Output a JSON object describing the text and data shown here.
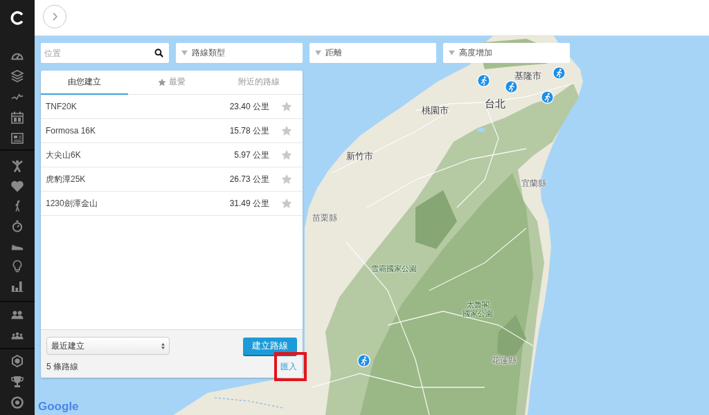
{
  "filters": {
    "location": {
      "placeholder": "位置"
    },
    "dropdowns": [
      {
        "label": "路線類型"
      },
      {
        "label": "距離"
      },
      {
        "label": "高度增加"
      }
    ]
  },
  "panel": {
    "tabs": [
      {
        "label": "由您建立",
        "kind": "plain",
        "selected": true
      },
      {
        "label": "最愛",
        "kind": "starred",
        "selected": false
      },
      {
        "label": "附近的路線",
        "kind": "plain",
        "selected": false
      }
    ],
    "routes": [
      {
        "name": "TNF20K",
        "distance": "23.40 公里",
        "favorite": false
      },
      {
        "name": "Formosa 16K",
        "distance": "15.78 公里",
        "favorite": false
      },
      {
        "name": "大尖山6K",
        "distance": "5.97 公里",
        "favorite": false
      },
      {
        "name": "虎豹潭25K",
        "distance": "26.73 公里",
        "favorite": false
      },
      {
        "name": "1230劍潭金山",
        "distance": "31.49 公里",
        "favorite": false
      }
    ],
    "sort": {
      "value": "最近建立"
    },
    "create_button": {
      "label": "建立路線"
    },
    "route_count": "5 條路線",
    "import_link": {
      "label": "匯入",
      "highlighted": true
    }
  },
  "map": {
    "labels": [
      {
        "text": "基隆市",
        "kind": "city"
      },
      {
        "text": "台北",
        "kind": "capital"
      },
      {
        "text": "桃園市",
        "kind": "city"
      },
      {
        "text": "新竹市",
        "kind": "city"
      },
      {
        "text": "宜蘭縣",
        "kind": "county"
      },
      {
        "text": "苗栗縣",
        "kind": "county"
      },
      {
        "text": "雪霸國家公園",
        "kind": "park"
      },
      {
        "text": "太魯閣",
        "kind": "park"
      },
      {
        "text": "國家公園",
        "kind": "park"
      },
      {
        "text": "花蓮縣",
        "kind": "county"
      }
    ],
    "logo": "Google"
  }
}
